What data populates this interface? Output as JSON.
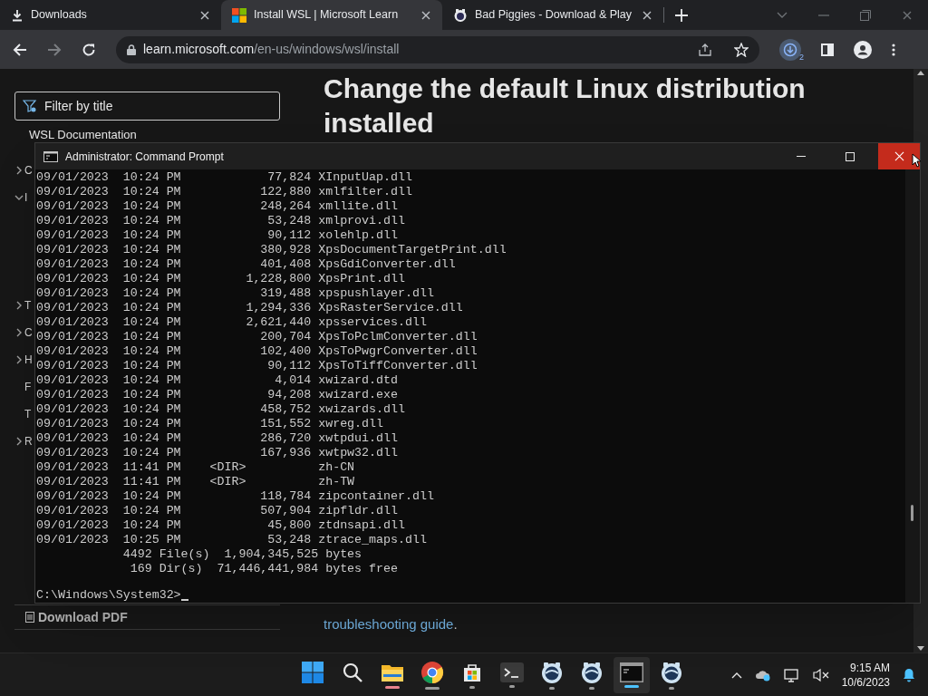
{
  "browser": {
    "tabs": [
      {
        "title": "Downloads",
        "kind": "download",
        "selected": false
      },
      {
        "title": "Install WSL | Microsoft Learn",
        "kind": "windows-logo",
        "selected": true
      },
      {
        "title": "Bad Piggies - Download & Play",
        "kind": "game",
        "selected": false
      }
    ],
    "address": {
      "host": "learn.microsoft.com",
      "path": "/en-us/windows/wsl/install"
    },
    "download_badge": "2"
  },
  "page": {
    "filter_placeholder": "Filter by title",
    "nav_header": "WSL Documentation",
    "nav_items": [
      {
        "label": "C",
        "kind": "collapsed"
      },
      {
        "label": "I",
        "kind": "expanded"
      },
      {
        "label": "T",
        "kind": "collapsed"
      },
      {
        "label": "C",
        "kind": "collapsed"
      },
      {
        "label": "H",
        "kind": "collapsed"
      },
      {
        "label": "F",
        "kind": "leaf"
      },
      {
        "label": "T",
        "kind": "leaf"
      },
      {
        "label": "R",
        "kind": "collapsed"
      }
    ],
    "download_pdf": "Download PDF",
    "heading": "Change the default Linux distribution installed",
    "paragraph_tail": [
      {
        "text": "troubleshooting guide",
        "kind": "link"
      },
      {
        "text": ".",
        "kind": "text"
      }
    ]
  },
  "console": {
    "title": "Administrator: Command Prompt",
    "lines": [
      "09/01/2023  10:24 PM            77,824 XInputUap.dll",
      "09/01/2023  10:24 PM           122,880 xmlfilter.dll",
      "09/01/2023  10:24 PM           248,264 xmllite.dll",
      "09/01/2023  10:24 PM            53,248 xmlprovi.dll",
      "09/01/2023  10:24 PM            90,112 xolehlp.dll",
      "09/01/2023  10:24 PM           380,928 XpsDocumentTargetPrint.dll",
      "09/01/2023  10:24 PM           401,408 XpsGdiConverter.dll",
      "09/01/2023  10:24 PM         1,228,800 XpsPrint.dll",
      "09/01/2023  10:24 PM           319,488 xpspushlayer.dll",
      "09/01/2023  10:24 PM         1,294,336 XpsRasterService.dll",
      "09/01/2023  10:24 PM         2,621,440 xpsservices.dll",
      "09/01/2023  10:24 PM           200,704 XpsToPclmConverter.dll",
      "09/01/2023  10:24 PM           102,400 XpsToPwgrConverter.dll",
      "09/01/2023  10:24 PM            90,112 XpsToTiffConverter.dll",
      "09/01/2023  10:24 PM             4,014 xwizard.dtd",
      "09/01/2023  10:24 PM            94,208 xwizard.exe",
      "09/01/2023  10:24 PM           458,752 xwizards.dll",
      "09/01/2023  10:24 PM           151,552 xwreg.dll",
      "09/01/2023  10:24 PM           286,720 xwtpdui.dll",
      "09/01/2023  10:24 PM           167,936 xwtpw32.dll",
      "09/01/2023  11:41 PM    <DIR>          zh-CN",
      "09/01/2023  11:41 PM    <DIR>          zh-TW",
      "09/01/2023  10:24 PM           118,784 zipcontainer.dll",
      "09/01/2023  10:24 PM           507,904 zipfldr.dll",
      "09/01/2023  10:24 PM            45,800 ztdnsapi.dll",
      "09/01/2023  10:25 PM            53,248 ztrace_maps.dll",
      "            4492 File(s)  1,904,345,525 bytes",
      "             169 Dir(s)  71,446,441,984 bytes free"
    ],
    "prompt": "C:\\Windows\\System32>"
  },
  "taskbar": {
    "apps": [
      {
        "kind": "start",
        "open": false,
        "selected": false
      },
      {
        "kind": "search",
        "open": false,
        "selected": false
      },
      {
        "kind": "folder",
        "open": true,
        "selected": false
      },
      {
        "kind": "browser",
        "open": true,
        "selected": false
      },
      {
        "kind": "store",
        "open": true,
        "selected": false
      },
      {
        "kind": "terminal",
        "open": true,
        "selected": false
      },
      {
        "kind": "game",
        "open": true,
        "selected": false
      },
      {
        "kind": "game",
        "open": true,
        "selected": false
      },
      {
        "kind": "console",
        "open": true,
        "selected": true
      },
      {
        "kind": "game",
        "open": true,
        "selected": false
      }
    ],
    "time": "9:15 AM",
    "date": "10/6/2023"
  }
}
